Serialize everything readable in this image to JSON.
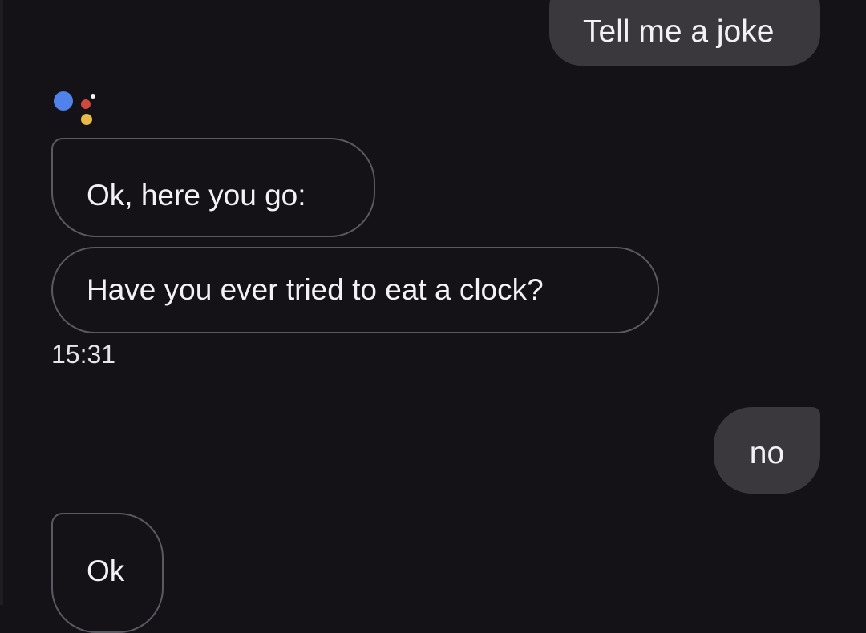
{
  "conversation": {
    "messages": [
      {
        "sender": "user",
        "text": "Tell me a joke"
      },
      {
        "sender": "assistant",
        "text": "Ok, here you go:"
      },
      {
        "sender": "assistant",
        "text": "Have you ever tried to eat a clock?"
      },
      {
        "sender": "user",
        "text": "no"
      },
      {
        "sender": "assistant",
        "text": "Ok"
      }
    ],
    "timestamp": "15:31"
  },
  "assistant_logo": {
    "icon": "google-assistant-icon",
    "colors": [
      "#4f82ea",
      "#d0493f",
      "#e7b94a",
      "#f4f4f4"
    ]
  },
  "theme": {
    "background": "#141217",
    "user_bubble": "#3a383d",
    "assistant_border": "#5b5960",
    "text": "#f3f1f5"
  }
}
